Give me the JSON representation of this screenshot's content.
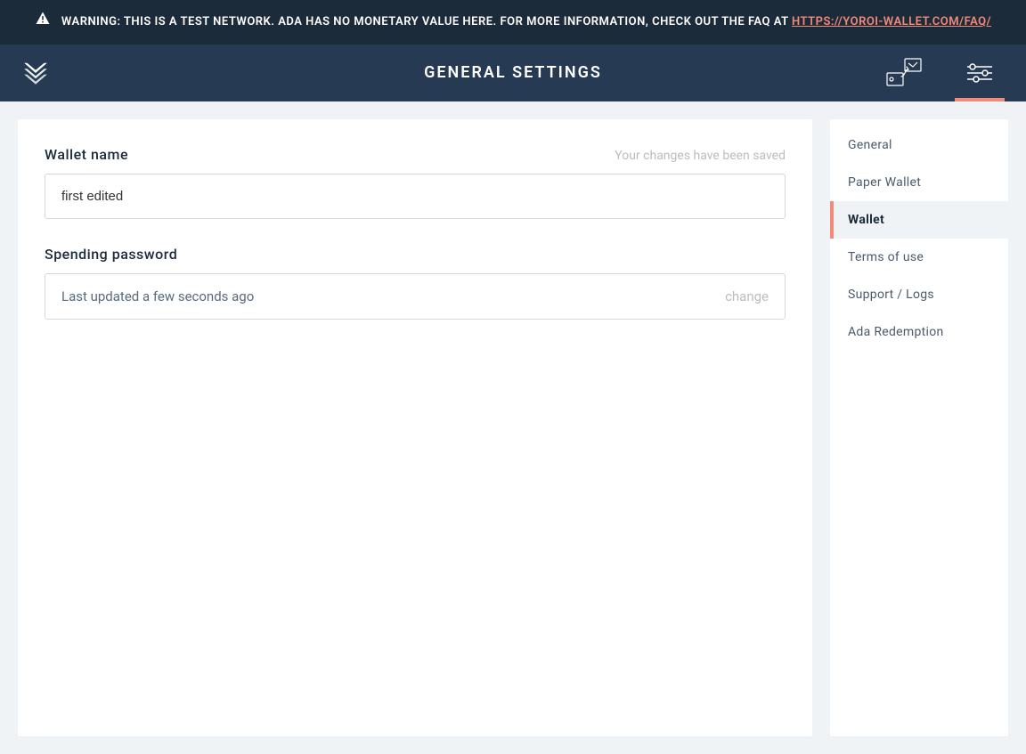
{
  "banner": {
    "text_before_link": "WARNING: THIS IS A TEST NETWORK. ADA HAS NO MONETARY VALUE HERE. FOR MORE INFORMATION, CHECK OUT THE FAQ AT ",
    "link_text": "HTTPS://YOROI-WALLET.COM/FAQ/"
  },
  "header": {
    "title": "GENERAL SETTINGS"
  },
  "main": {
    "wallet_name": {
      "label": "Wallet name",
      "saved_msg": "Your changes have been saved",
      "value": "first edited"
    },
    "spending_password": {
      "label": "Spending password",
      "updated": "Last updated a few seconds ago",
      "change": "change"
    }
  },
  "sidebar": {
    "items": [
      {
        "label": "General",
        "active": false
      },
      {
        "label": "Paper Wallet",
        "active": false
      },
      {
        "label": "Wallet",
        "active": true
      },
      {
        "label": "Terms of use",
        "active": false
      },
      {
        "label": "Support / Logs",
        "active": false
      },
      {
        "label": "Ada Redemption",
        "active": false
      }
    ]
  }
}
